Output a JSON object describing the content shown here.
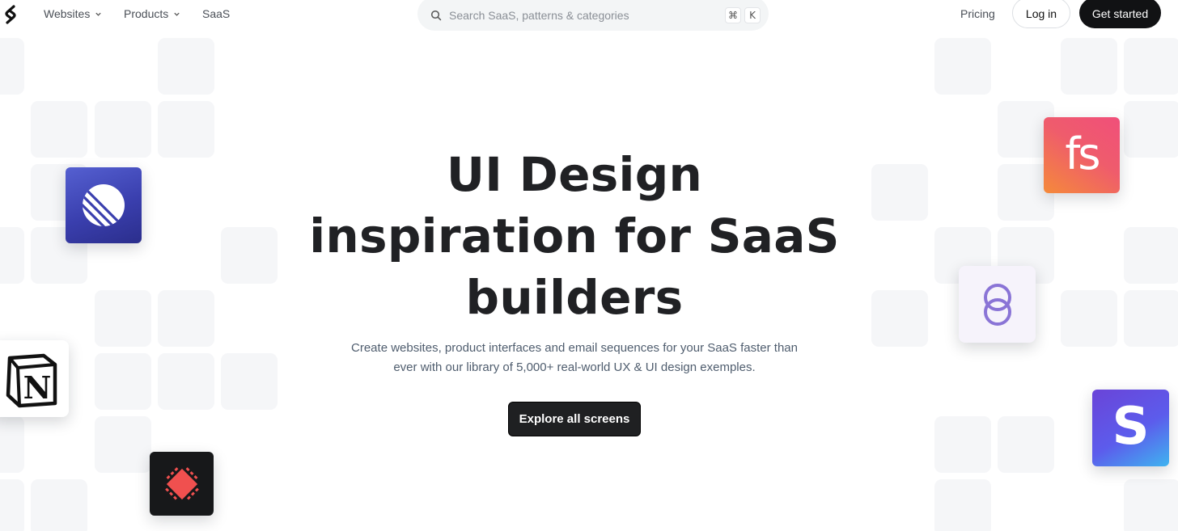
{
  "nav": {
    "links": [
      {
        "label": "Websites"
      },
      {
        "label": "Products"
      },
      {
        "label": "SaaS"
      }
    ],
    "search": {
      "placeholder": "Search SaaS, patterns & categories",
      "shortcut_cmd": "⌘",
      "shortcut_key": "K"
    },
    "pricing": "Pricing",
    "login": "Log in",
    "get_started": "Get started"
  },
  "hero": {
    "title_line1": "UI Design",
    "title_line2": "inspiration for SaaS",
    "title_line3": "builders",
    "subtitle_line1": "Create websites, product interfaces and email sequences for your SaaS faster than",
    "subtitle_line2": "ever with our library of 5,000+ real-world UX & UI design exemples.",
    "cta": "Explore all screens"
  },
  "apps": {
    "linear": {
      "icon": "linear-logo-icon",
      "color": "#3a3fae"
    },
    "notion": {
      "icon": "notion-logo-icon",
      "glyph": "N"
    },
    "tool": {
      "icon": "red-diamond-logo-icon",
      "color": "#f0504f"
    },
    "fs": {
      "icon": "fs-logo-icon",
      "glyph": "fs"
    },
    "rings": {
      "icon": "interlocked-rings-logo-icon",
      "color": "#8a74d6"
    },
    "stripe": {
      "icon": "stripe-logo-icon",
      "glyph": "S"
    }
  },
  "colors": {
    "accent": "#111214",
    "tile": "#f5f6f8",
    "text": "#202124",
    "muted": "#4f5d6e"
  }
}
